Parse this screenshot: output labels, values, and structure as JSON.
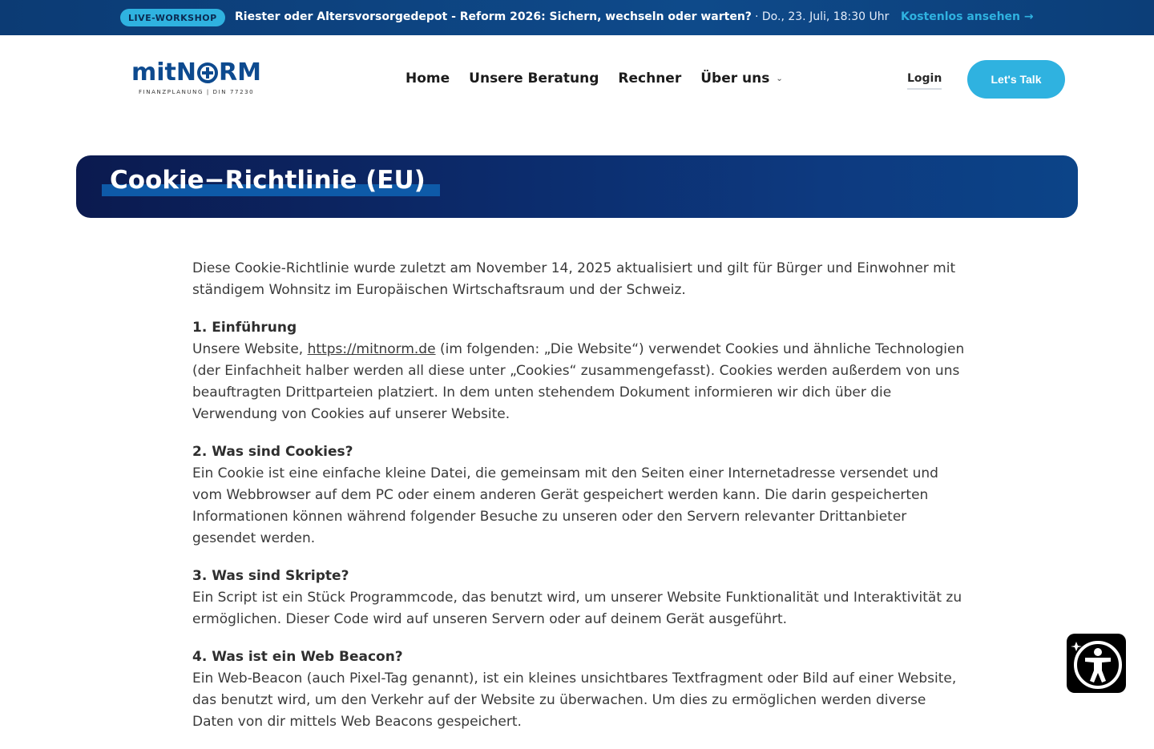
{
  "promo": {
    "badge": "LIVE-WORKSHOP",
    "headline": "Riester oder Altersvorsorgedepot - Reform 2026: Sichern, wechseln oder warten?",
    "date": "· Do., 23. Juli, 18:30 Uhr",
    "cta": "Kostenlos ansehen →"
  },
  "logo": {
    "word_left": "mitN",
    "word_right": "RM",
    "tagline": "FINANZPLANUNG | DIN 77230"
  },
  "nav": {
    "items": [
      {
        "label": "Home"
      },
      {
        "label": "Unsere Beratung"
      },
      {
        "label": "Rechner"
      },
      {
        "label": "Über uns"
      }
    ]
  },
  "header": {
    "login": "Login",
    "cta": "Let's Talk"
  },
  "page": {
    "title": "Cookie−Richtlinie (EU)"
  },
  "content": {
    "intro": "Diese Cookie-Richtlinie wurde zuletzt am November 14, 2025 aktualisiert und gilt für Bürger und Einwohner mit ständigem Wohnsitz im Europäischen Wirtschaftsraum und der Schweiz.",
    "sections": [
      {
        "heading": "1. Einführung",
        "text_before": "Unsere Website, ",
        "link": "https://mitnorm.de",
        "text_after": " (im folgenden: „Die Website“) verwendet Cookies und ähnliche Technologien (der Einfachheit halber werden all diese unter „Cookies“ zusammengefasst). Cookies werden außerdem von uns beauftragten Drittparteien platziert. In dem unten stehendem Dokument informieren wir dich über die Verwendung von Cookies auf unserer Website."
      },
      {
        "heading": "2. Was sind Cookies?",
        "text": "Ein Cookie ist eine einfache kleine Datei, die gemeinsam mit den Seiten einer Internetadresse versendet und vom Webbrowser auf dem PC oder einem anderen Gerät gespeichert werden kann. Die darin gespeicherten Informationen können während folgender Besuche zu unseren oder den Servern relevanter Drittanbieter gesendet werden."
      },
      {
        "heading": "3. Was sind Skripte?",
        "text": "Ein Script ist ein Stück Programmcode, das benutzt wird, um unserer Website Funktionalität und Interaktivität zu ermöglichen. Dieser Code wird auf unseren Servern oder auf deinem Gerät ausgeführt."
      },
      {
        "heading": "4. Was ist ein Web Beacon?",
        "text": "Ein Web-Beacon (auch Pixel-Tag genannt), ist ein kleines unsichtbares Textfragment oder Bild auf einer Website, das benutzt wird, um den Verkehr auf der Website zu überwachen. Um dies zu ermöglichen werden diverse Daten von dir mittels Web Beacons gespeichert."
      }
    ]
  },
  "a11y": {
    "icon": "accessibility-icon"
  },
  "colors": {
    "brand": "#0d4a8f",
    "accent": "#2fb2e0",
    "banner_dark": "#0b1a4f"
  }
}
